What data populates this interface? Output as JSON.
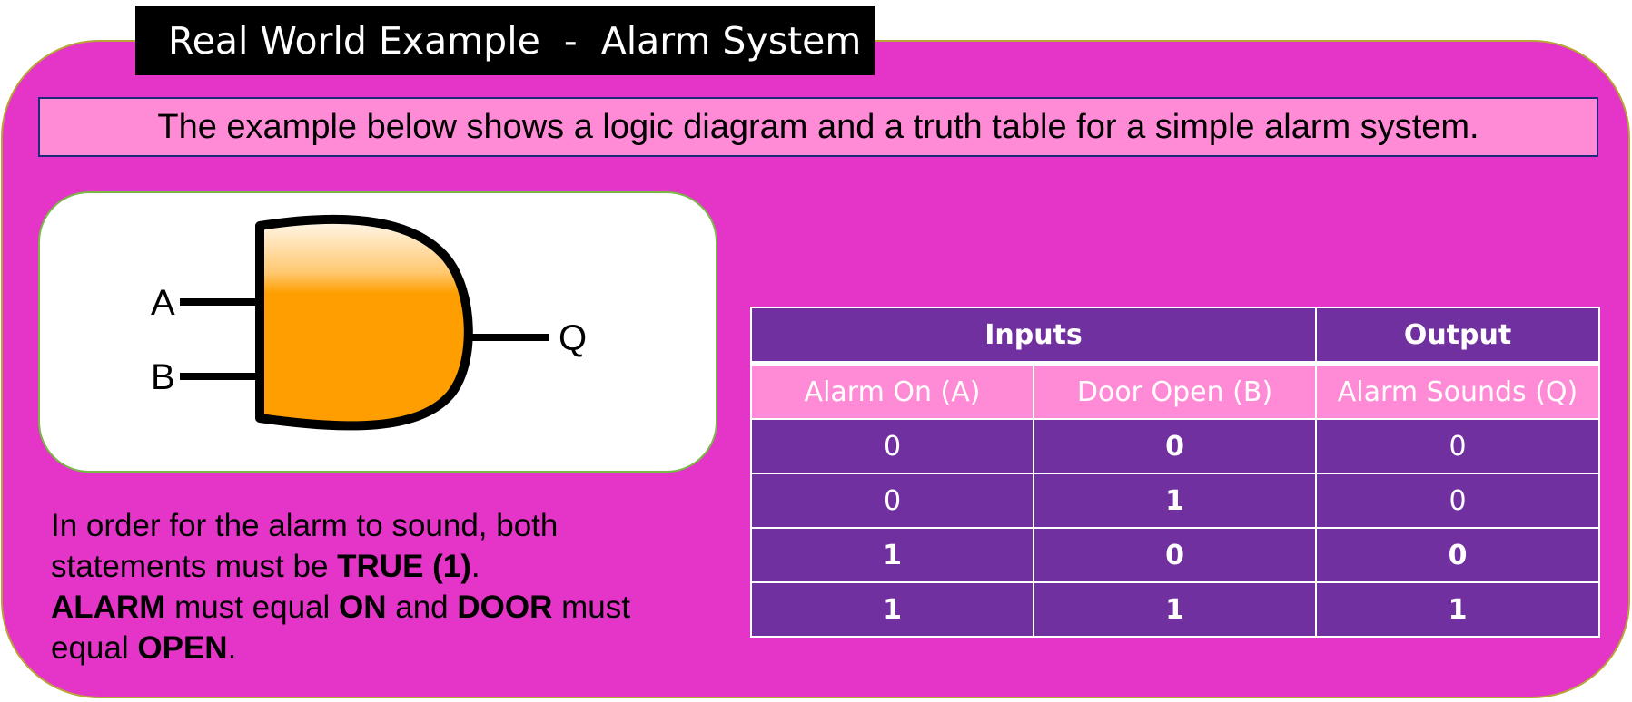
{
  "title": "Real World Example  -  Alarm System",
  "subtitle": "The example below shows a logic diagram and a truth table for a simple alarm system.",
  "diagram": {
    "gate_type": "AND",
    "input_a": "A",
    "input_b": "B",
    "output": "Q",
    "gate_colors": {
      "fill": "#ff9e00",
      "highlight": "#ffffff",
      "outline": "#000000"
    }
  },
  "explanation": {
    "line1": "In order for the alarm to sound, both",
    "line2_pre": "statements must be ",
    "line2_bold": "TRUE (1)",
    "line2_post": ".",
    "line3_b1": "ALARM",
    "line3_t1": " must equal ",
    "line3_b2": "ON",
    "line3_t2": " and ",
    "line3_b3": "DOOR",
    "line3_t3": " must",
    "line4_pre": "equal ",
    "line4_bold": "OPEN",
    "line4_post": "."
  },
  "table": {
    "group_inputs": "Inputs",
    "group_output": "Output",
    "headers": [
      "Alarm On (A)",
      "Door Open (B)",
      "Alarm Sounds (Q)"
    ],
    "rows": [
      [
        "0",
        "0",
        "0"
      ],
      [
        "0",
        "1",
        "0"
      ],
      [
        "1",
        "0",
        "0"
      ],
      [
        "1",
        "1",
        "1"
      ]
    ]
  },
  "colors": {
    "panel": "#e535c8",
    "panel_border": "#b7a535",
    "subtitle_bg": "#ff8ad6",
    "table_dark": "#7030a0",
    "table_light": "#ff8ad6"
  }
}
